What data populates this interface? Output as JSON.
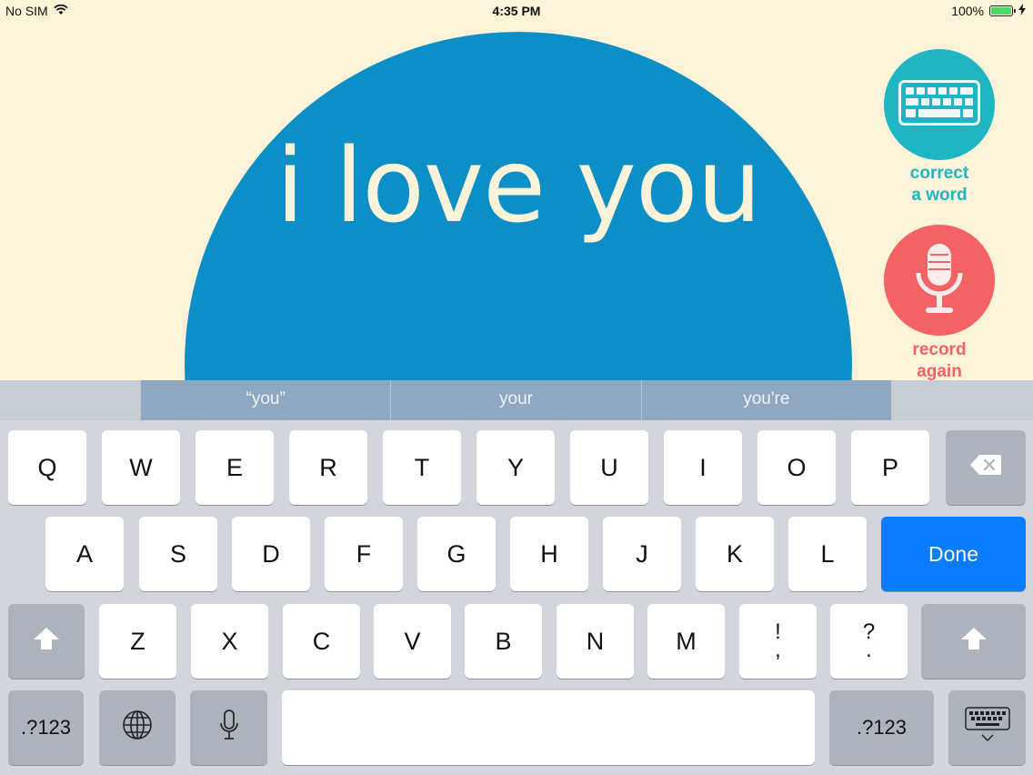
{
  "status_bar": {
    "carrier": "No SIM",
    "time": "4:35 PM",
    "battery_text": "100%",
    "battery_level": 1.0
  },
  "main": {
    "phrase": "i love you"
  },
  "actions": {
    "correct_label": [
      "correct",
      "a word"
    ],
    "record_label": [
      "record",
      "again"
    ]
  },
  "colors": {
    "circle": "#0b8fc6",
    "correct": "#1eb6c3",
    "record": "#f46364",
    "done": "#0a7cff",
    "background": "#fcf3d9"
  },
  "keyboard": {
    "suggestions": [
      "“you”",
      "your",
      "you're"
    ],
    "row1": [
      "Q",
      "W",
      "E",
      "R",
      "T",
      "Y",
      "U",
      "I",
      "O",
      "P"
    ],
    "row2": [
      "A",
      "S",
      "D",
      "F",
      "G",
      "H",
      "J",
      "K",
      "L"
    ],
    "row3": [
      "Z",
      "X",
      "C",
      "V",
      "B",
      "N",
      "M"
    ],
    "punct1": [
      "!",
      ","
    ],
    "punct2": [
      "?",
      "."
    ],
    "done": "Done",
    "numbers": ".?123",
    "icons": {
      "delete": "delete-icon",
      "shift": "shift-icon",
      "globe": "globe-icon",
      "mic": "microphone-icon",
      "hide": "keyboard-hide-icon"
    }
  }
}
